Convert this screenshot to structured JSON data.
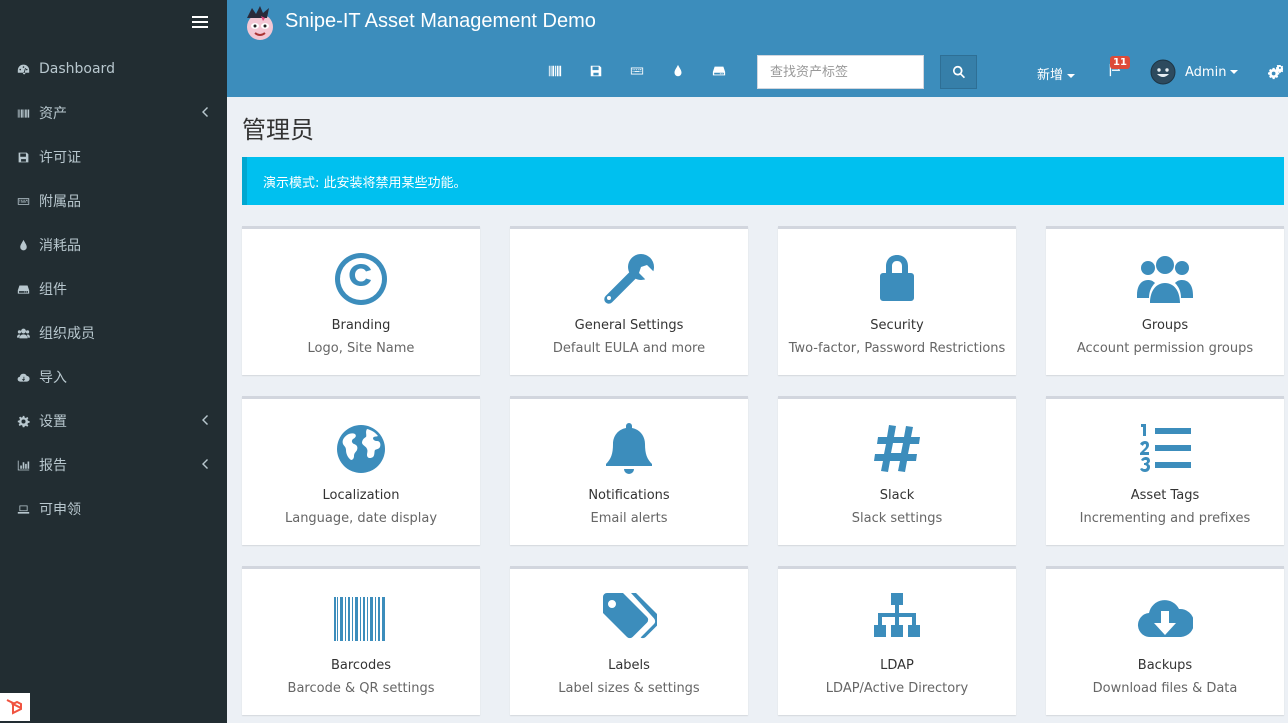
{
  "app": {
    "title": "Snipe-IT Asset Management Demo"
  },
  "sidebar": {
    "items": [
      {
        "label": "Dashboard",
        "icon": "dashboard-icon",
        "has_children": false
      },
      {
        "label": "资产",
        "icon": "barcode-icon",
        "has_children": true
      },
      {
        "label": "许可证",
        "icon": "floppy-icon",
        "has_children": false
      },
      {
        "label": "附属品",
        "icon": "keyboard-icon",
        "has_children": false
      },
      {
        "label": "消耗品",
        "icon": "tint-icon",
        "has_children": false
      },
      {
        "label": "组件",
        "icon": "hdd-icon",
        "has_children": false
      },
      {
        "label": "组织成员",
        "icon": "users-icon",
        "has_children": false
      },
      {
        "label": "导入",
        "icon": "cloud-download-icon",
        "has_children": false
      },
      {
        "label": "设置",
        "icon": "cog-icon",
        "has_children": true
      },
      {
        "label": "报告",
        "icon": "bar-chart-icon",
        "has_children": true
      },
      {
        "label": "可申领",
        "icon": "laptop-icon",
        "has_children": false
      }
    ]
  },
  "header": {
    "search": {
      "placeholder": "查找资产标签",
      "value": ""
    },
    "new_label": "新增",
    "notification_count": "11",
    "user_name": "Admin"
  },
  "main": {
    "page_title": "管理员",
    "alert_text": "演示模式: 此安装将禁用某些功能。",
    "cards": [
      {
        "title": "Branding",
        "subtitle": "Logo, Site Name",
        "icon": "copyright-icon"
      },
      {
        "title": "General Settings",
        "subtitle": "Default EULA and more",
        "icon": "wrench-icon"
      },
      {
        "title": "Security",
        "subtitle": "Two-factor, Password Restrictions",
        "icon": "lock-icon"
      },
      {
        "title": "Groups",
        "subtitle": "Account permission groups",
        "icon": "group-icon"
      },
      {
        "title": "Localization",
        "subtitle": "Language, date display",
        "icon": "globe-icon"
      },
      {
        "title": "Notifications",
        "subtitle": "Email alerts",
        "icon": "bell-icon"
      },
      {
        "title": "Slack",
        "subtitle": "Slack settings",
        "icon": "hashtag-icon"
      },
      {
        "title": "Asset Tags",
        "subtitle": "Incrementing and prefixes",
        "icon": "ordered-list-icon"
      },
      {
        "title": "Barcodes",
        "subtitle": "Barcode & QR settings",
        "icon": "barcode-icon"
      },
      {
        "title": "Labels",
        "subtitle": "Label sizes & settings",
        "icon": "tags-icon"
      },
      {
        "title": "LDAP",
        "subtitle": "LDAP/Active Directory",
        "icon": "sitemap-icon"
      },
      {
        "title": "Backups",
        "subtitle": "Download files & Data",
        "icon": "cloud-download-icon"
      }
    ]
  },
  "colors": {
    "header": "#3c8dbc",
    "sidebar": "#222d32",
    "alert": "#00c0ef",
    "accent": "#3c8dbc",
    "badge": "#dd4b39"
  }
}
